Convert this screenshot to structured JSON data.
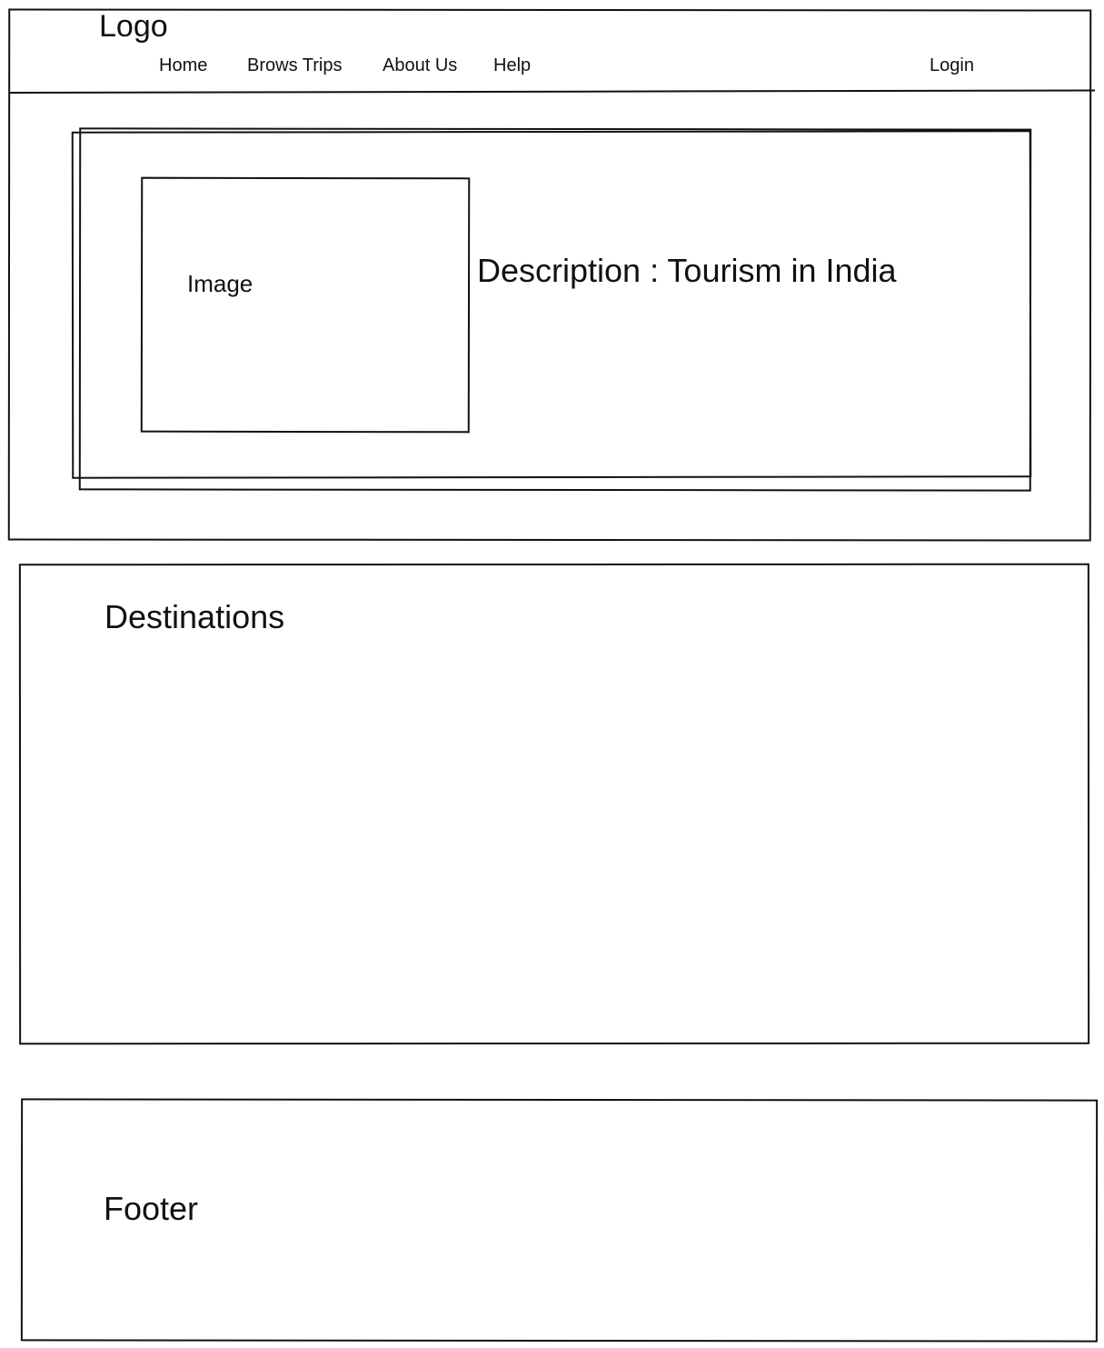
{
  "header": {
    "logo_text": "Logo",
    "nav": {
      "home": "Home",
      "browse": "Brows Trips",
      "about": "About Us",
      "help": "Help",
      "login": "Login"
    }
  },
  "hero": {
    "image_label": "Image",
    "description": "Description : Tourism in India"
  },
  "destinations": {
    "title": "Destinations"
  },
  "footer": {
    "label": "Footer"
  }
}
